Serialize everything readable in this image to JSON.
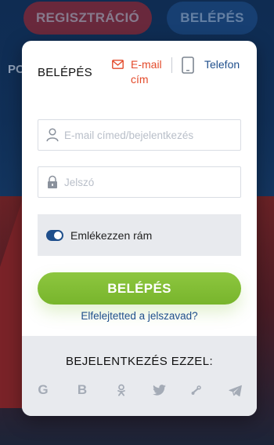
{
  "background": {
    "register_label": "REGISZTRÁCIÓ",
    "login_label": "BELÉPÉS",
    "partial_text": "PO"
  },
  "modal": {
    "title": "BELÉPÉS",
    "tabs": {
      "email_label": "E-mail cím",
      "phone_label": "Telefon",
      "active": "email"
    },
    "email_field": {
      "placeholder": "E-mail címed/bejelentkezés",
      "value": ""
    },
    "password_field": {
      "placeholder": "Jelszó",
      "value": ""
    },
    "remember": {
      "label": "Emlékezzen rám",
      "checked": true
    },
    "login_button_label": "BELÉPÉS",
    "forgot_link": "Elfelejtetted a jelszavad?",
    "social": {
      "title": "BEJELENTKEZÉS EZZEL:",
      "icons": [
        "google-icon",
        "vk-icon",
        "odnoklassniki-icon",
        "twitter-icon",
        "steam-icon",
        "telegram-icon"
      ]
    }
  },
  "colors": {
    "accent_orange": "#e34a2a",
    "brand_blue": "#1f4f8c",
    "button_green": "#8dc63f",
    "icon_gray": "#a4abb6"
  }
}
